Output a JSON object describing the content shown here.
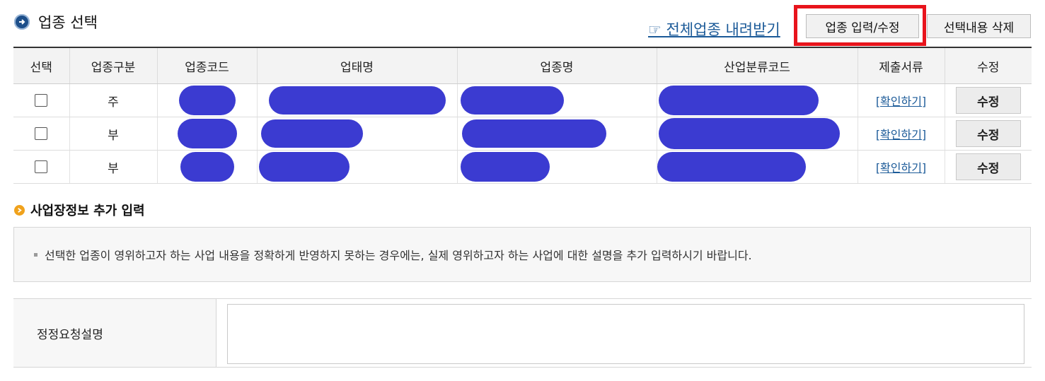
{
  "header": {
    "title": "업종 선택",
    "download_link": "☞ 전체업종 내려받기",
    "input_button": "업종 입력/수정",
    "delete_button": "선택내용 삭제"
  },
  "table": {
    "headers": [
      "선택",
      "업종구분",
      "업종코드",
      "업태명",
      "업종명",
      "산업분류코드",
      "제출서류",
      "수정"
    ],
    "rows": [
      {
        "type": "주",
        "confirm": "[확인하기]",
        "edit": "수정"
      },
      {
        "type": "부",
        "confirm": "[확인하기]",
        "edit": "수정"
      },
      {
        "type": "부",
        "confirm": "[확인하기]",
        "edit": "수정"
      }
    ]
  },
  "extra": {
    "title": "사업장정보 추가 입력",
    "notice": "선택한 업종이 영위하고자 하는 사업 내용을 정확하게 반영하지 못하는 경우에는, 실제 영위하고자 하는 사업에 대한 설명을 추가 입력하시기 바랍니다.",
    "label": "정정요청설명",
    "textarea_value": ""
  },
  "colors": {
    "accent": "#1b5a98",
    "highlight": "#e8141c",
    "redaction": "#3b3bd1",
    "orange": "#f0a21c"
  }
}
